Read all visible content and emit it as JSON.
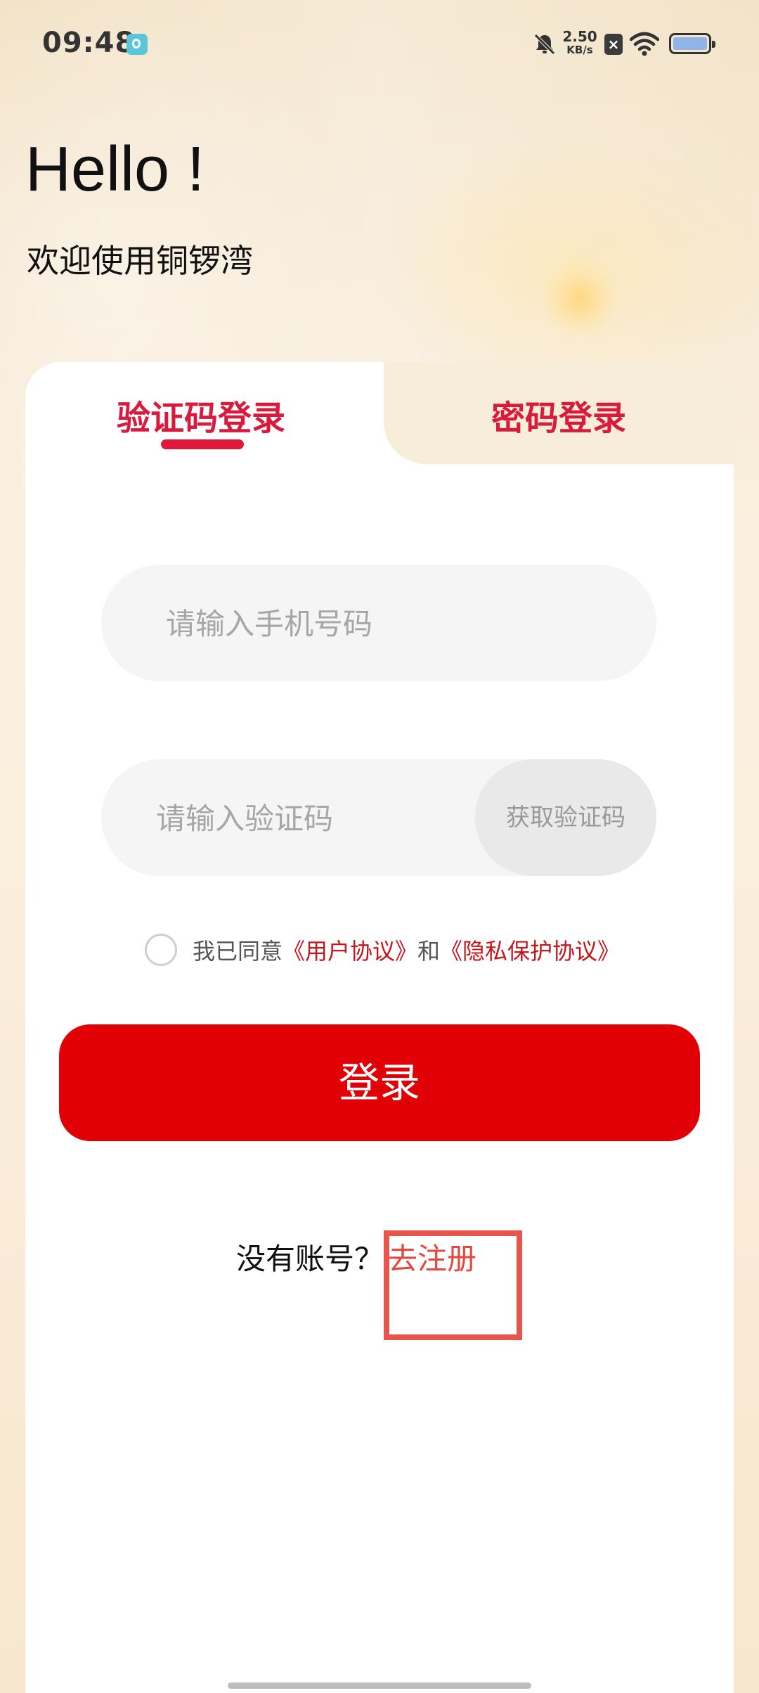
{
  "status_bar": {
    "time": "09:48",
    "net_speed_value": "2.50",
    "net_speed_unit": "KB/s",
    "icons": [
      "app-notify-icon",
      "bell-off-icon",
      "sim-x-icon",
      "wifi-icon",
      "battery-icon"
    ]
  },
  "header": {
    "hello": "Hello !",
    "welcome": "欢迎使用铜锣湾"
  },
  "tabs": {
    "sms_login": "验证码登录",
    "password_login": "密码登录",
    "active": "sms_login"
  },
  "form": {
    "phone_placeholder": "请输入手机号码",
    "code_placeholder": "请输入验证码",
    "get_code_label": "获取验证码"
  },
  "agreement": {
    "prefix": "我已同意",
    "user_agreement": "《用户协议》",
    "and": "和",
    "privacy_agreement": "《隐私保护协议》",
    "checked": false
  },
  "login_button": "登录",
  "register": {
    "prompt": "没有账号？",
    "link": "去注册"
  },
  "colors": {
    "accent_red": "#e10006",
    "tab_red": "#d81b3c",
    "link_red": "#c8141b",
    "register_link": "#e5463d",
    "highlight_box": "#e8554d"
  }
}
